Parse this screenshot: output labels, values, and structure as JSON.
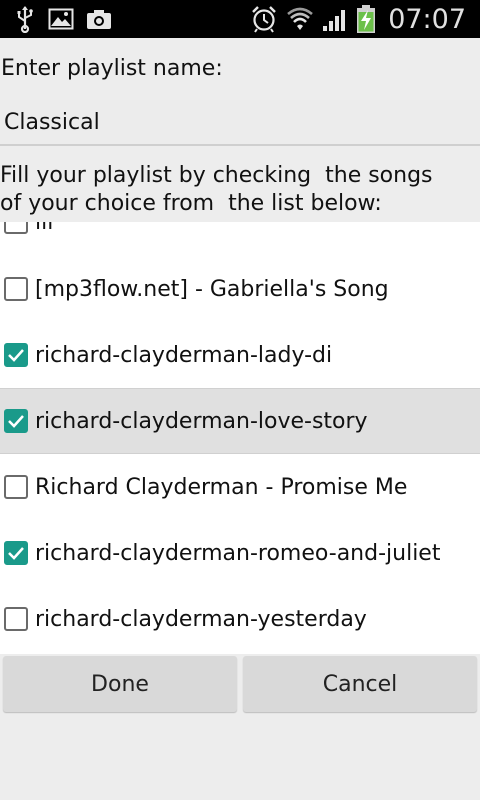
{
  "status_bar": {
    "time": "07:07",
    "left_icons": [
      "usb-icon",
      "image-icon",
      "camera-icon"
    ],
    "right_icons": [
      "alarm-icon",
      "wifi-icon",
      "signal-icon",
      "battery-charging-icon"
    ]
  },
  "form": {
    "name_label": "Enter playlist name:",
    "name_value": "Classical",
    "instructions": "Fill your playlist by checking  the songs of your choice from  the list below:"
  },
  "songs": [
    {
      "label": "lll",
      "checked": false
    },
    {
      "label": "[mp3flow.net] - Gabriella's Song",
      "checked": false
    },
    {
      "label": "richard-clayderman-lady-di",
      "checked": true
    },
    {
      "label": "richard-clayderman-love-story",
      "checked": true,
      "highlighted": true
    },
    {
      "label": "Richard Clayderman - Promise Me",
      "checked": false
    },
    {
      "label": "richard-clayderman-romeo-and-juliet",
      "checked": true
    },
    {
      "label": "richard-clayderman-yesterday",
      "checked": false
    }
  ],
  "buttons": {
    "done": "Done",
    "cancel": "Cancel"
  },
  "colors": {
    "checkbox_checked": "#1a9a8a",
    "highlight_row": "#e0e0e0",
    "background": "#ededed"
  }
}
